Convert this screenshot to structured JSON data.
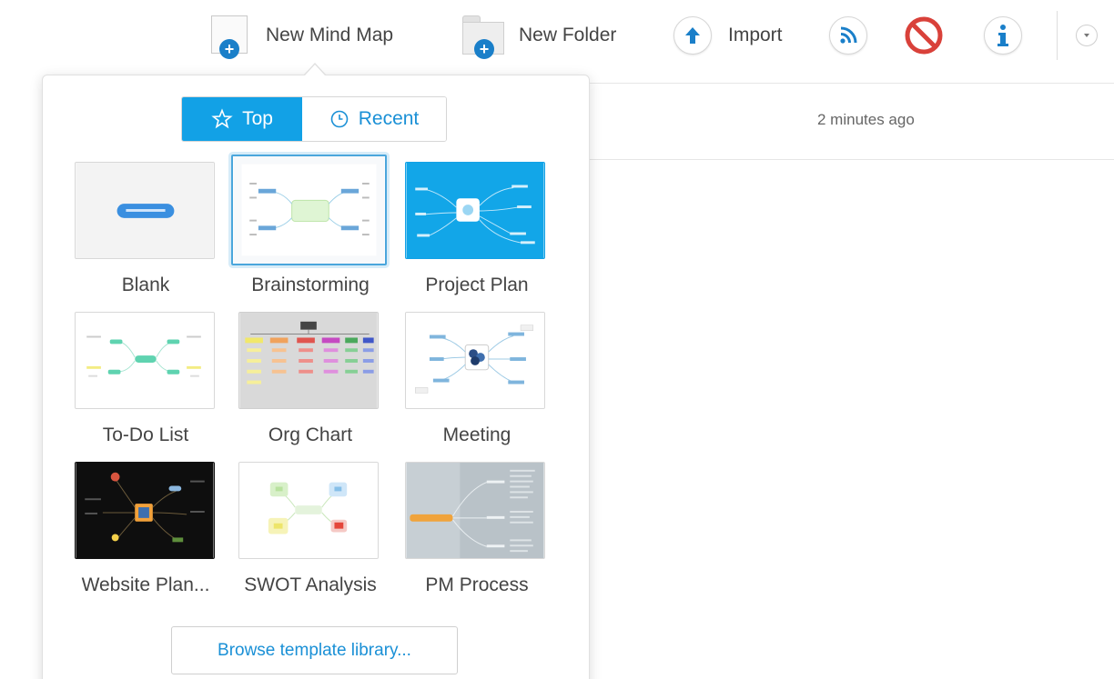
{
  "toolbar": {
    "new_mind_map_label": "New Mind Map",
    "new_folder_label": "New Folder",
    "import_label": "Import"
  },
  "list": {
    "row_time": "2 minutes ago"
  },
  "popup": {
    "tabs": {
      "top_label": "Top",
      "recent_label": "Recent"
    },
    "templates": [
      {
        "label": "Blank"
      },
      {
        "label": "Brainstorming"
      },
      {
        "label": "Project Plan"
      },
      {
        "label": "To-Do List"
      },
      {
        "label": "Org Chart"
      },
      {
        "label": "Meeting"
      },
      {
        "label": "Website Plan..."
      },
      {
        "label": "SWOT Analysis"
      },
      {
        "label": "PM Process"
      }
    ],
    "browse_label": "Browse template library...",
    "selected_template": "Brainstorming"
  },
  "colors": {
    "accent": "#12a1e6",
    "link": "#1a90d6",
    "plus_badge": "#1a7fc9",
    "block_red": "#d9413a",
    "rss_blue": "#1a7fc9"
  },
  "icons": [
    "document-plus-icon",
    "folder-plus-icon",
    "upload-arrow-icon",
    "rss-icon",
    "block-icon",
    "info-icon",
    "chevron-down-icon",
    "star-icon",
    "clock-icon"
  ]
}
